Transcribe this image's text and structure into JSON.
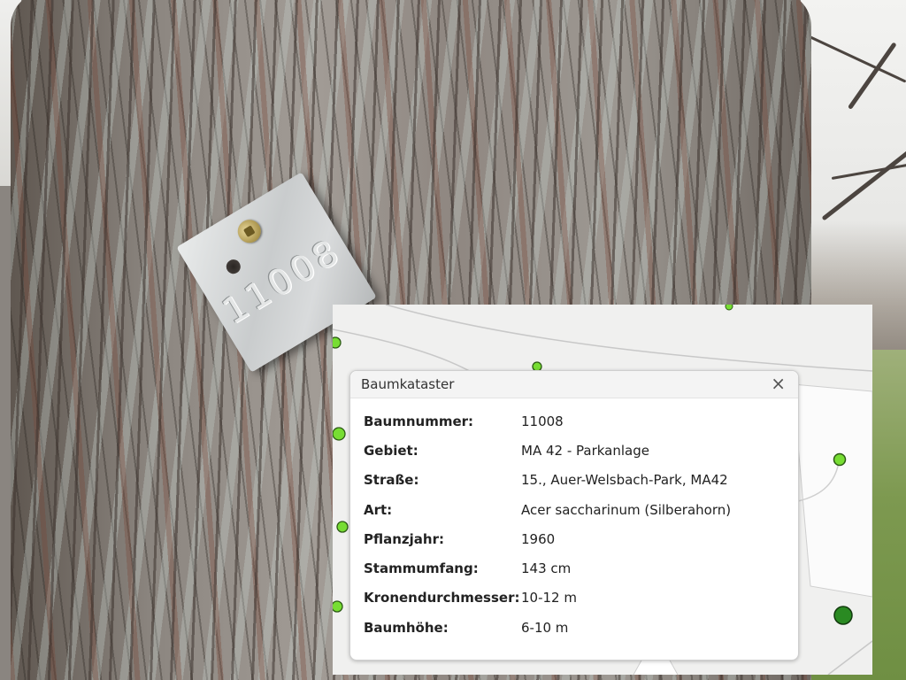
{
  "tag": {
    "number": "11008"
  },
  "popup": {
    "title": "Baumkataster",
    "close_glyph": "×",
    "rows": [
      {
        "label": "Baumnummer:",
        "value": "11008"
      },
      {
        "label": "Gebiet:",
        "value": "MA 42 - Parkanlage"
      },
      {
        "label": "Straße:",
        "value": "15., Auer-Welsbach-Park, MA42"
      },
      {
        "label": "Art:",
        "value": "Acer saccharinum (Silberahorn)"
      },
      {
        "label": "Pflanzjahr:",
        "value": "1960"
      },
      {
        "label": "Stammumfang:",
        "value": "143 cm"
      },
      {
        "label": "Kronendurchmesser:",
        "value": "10-12 m"
      },
      {
        "label": "Baumhöhe:",
        "value": "6-10 m"
      }
    ]
  },
  "colors": {
    "marker_light": "#77dd33",
    "marker_dark": "#2a8a22",
    "map_background": "#f0f0ef"
  }
}
